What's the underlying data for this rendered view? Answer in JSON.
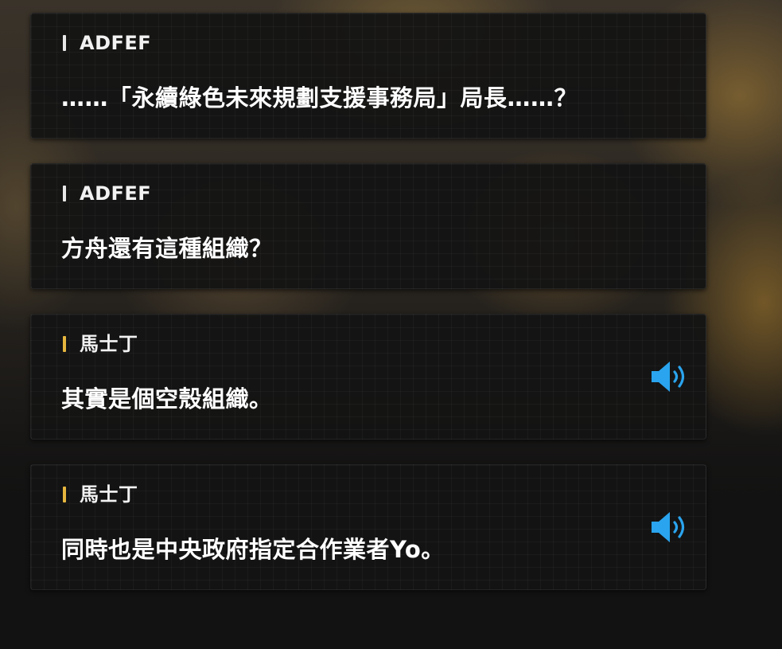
{
  "dialogue": [
    {
      "speaker": "ADFEF",
      "text": "……「永續綠色未來規劃支援事務局」局長……？",
      "bar_color": "#e8e8e8",
      "has_voice": false
    },
    {
      "speaker": "ADFEF",
      "text": "方舟還有這種組織？",
      "bar_color": "#e8e8e8",
      "has_voice": false
    },
    {
      "speaker": "馬士丁",
      "text": "其實是個空殼組織。",
      "bar_color": "#e6b63e",
      "has_voice": true,
      "voice_icon": "speaker-volume-icon"
    },
    {
      "speaker": "馬士丁",
      "text": "同時也是中央政府指定合作業者Yo。",
      "bar_color": "#e6b63e",
      "has_voice": true,
      "voice_icon": "speaker-volume-icon"
    }
  ],
  "colors": {
    "voice_icon": "#2aa4ee",
    "player_bar": "#e8e8e8",
    "npc_bar": "#e6b63e"
  }
}
